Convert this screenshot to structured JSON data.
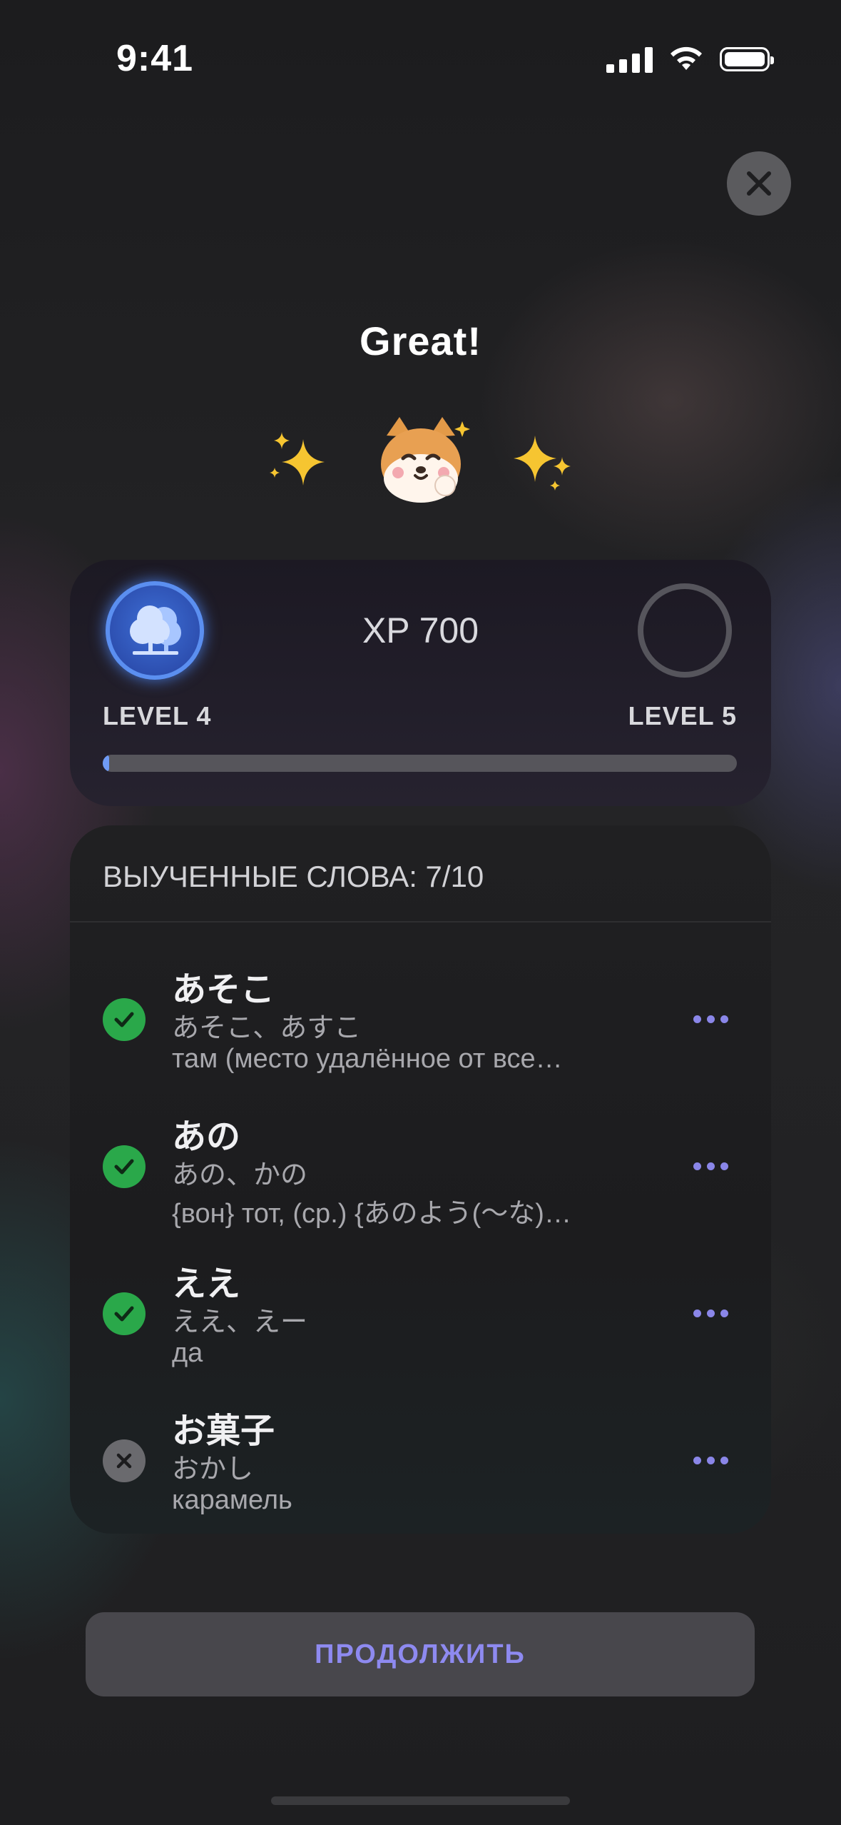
{
  "status_bar": {
    "time": "9:41"
  },
  "title": "Great!",
  "level_card": {
    "xp_label": "XP 700",
    "current_level": "LEVEL 4",
    "next_level": "LEVEL 5",
    "progress_fraction": 0.01
  },
  "words": {
    "header": "ВЫУЧЕННЫЕ СЛОВА: 7/10",
    "items": [
      {
        "word": "あそこ",
        "reading": "あそこ、あすこ",
        "translation": " там (место удалённое от все…",
        "learned": true
      },
      {
        "word": "あの",
        "reading": "あの、かの",
        "translation": "{вон} тот, (ср.) {あのよう(〜な)…",
        "learned": true
      },
      {
        "word": "ええ",
        "reading": "ええ、えー",
        "translation": "да",
        "learned": true
      },
      {
        "word": "お菓子",
        "reading": "おかし",
        "translation": "карамель",
        "learned": false
      }
    ]
  },
  "continue_label": "ПРОДОЛЖИТЬ",
  "colors": {
    "accent": "#8e8af0",
    "success": "#2aa84a",
    "level_badge": "#3e6fd6"
  }
}
